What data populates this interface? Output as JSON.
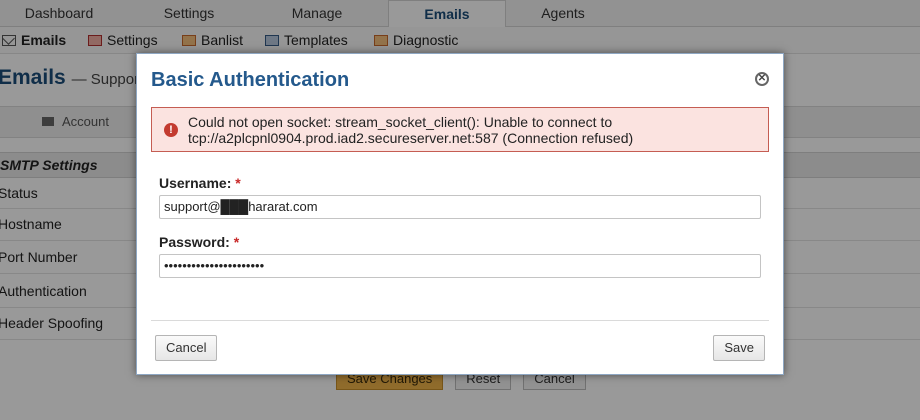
{
  "topnav": {
    "tabs": [
      {
        "label": "Dashboard"
      },
      {
        "label": "Settings"
      },
      {
        "label": "Manage"
      },
      {
        "label": "Emails"
      },
      {
        "label": "Agents"
      }
    ],
    "active": "Emails"
  },
  "subnav": {
    "items": [
      {
        "label": "Emails",
        "icon": "envelope-icon"
      },
      {
        "label": "Settings",
        "icon": "settings-icon"
      },
      {
        "label": "Banlist",
        "icon": "banlist-icon"
      },
      {
        "label": "Templates",
        "icon": "templates-icon"
      },
      {
        "label": "Diagnostic",
        "icon": "diagnostic-icon"
      }
    ]
  },
  "page": {
    "title": "Emails",
    "subtitle": "— Support",
    "content_tab": "Account",
    "section": "SMTP Settings",
    "fields": [
      "Status",
      "Hostname",
      "Port Number",
      "Authentication",
      "Header Spoofing"
    ],
    "actions": {
      "save": "Save Changes",
      "reset": "Reset",
      "cancel": "Cancel"
    }
  },
  "modal": {
    "title": "Basic Authentication",
    "error": "Could not open socket: stream_socket_client(): Unable to connect to tcp://a2plcpnl0904.prod.iad2.secureserver.net:587 (Connection refused)",
    "username_label": "Username:",
    "username_value": "support@███hararat.com",
    "password_label": "Password:",
    "password_value": "••••••••••••••••••••••",
    "required_marker": "*",
    "cancel_label": "Cancel",
    "save_label": "Save"
  },
  "colors": {
    "title_blue": "#24598c",
    "error_bg": "#fbe3e0",
    "error_border": "#c55d53",
    "required_red": "#c82828"
  }
}
